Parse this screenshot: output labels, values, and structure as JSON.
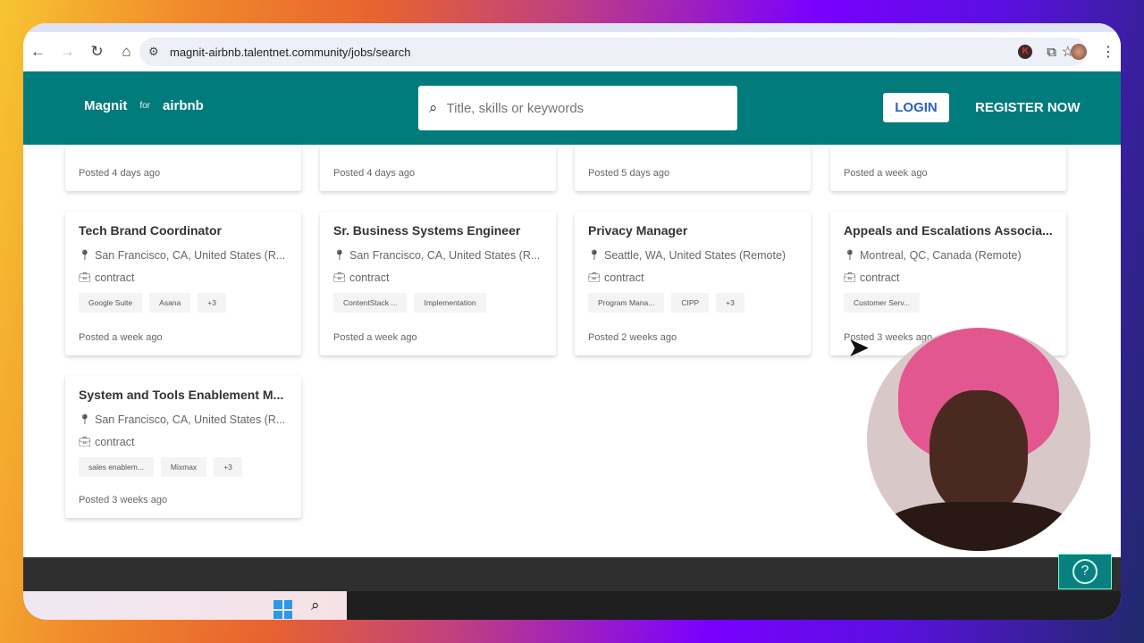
{
  "browser": {
    "url": "magnit-airbnb.talentnet.community/jobs/search",
    "profile_initial": "K"
  },
  "header": {
    "logo_magnit": "Magnit",
    "logo_for": "for",
    "logo_airbnb": "airbnb",
    "search_placeholder": "Title, skills or keywords",
    "login": "LOGIN",
    "register": "REGISTER NOW"
  },
  "partial_cards": [
    {
      "posted": "Posted 4 days ago"
    },
    {
      "posted": "Posted 4 days ago"
    },
    {
      "posted": "Posted 5 days ago"
    },
    {
      "posted": "Posted a week ago"
    }
  ],
  "jobs": [
    {
      "title": "Tech Brand Coordinator",
      "location": "San Francisco, CA, United States (R...",
      "type": "contract",
      "tags": [
        "Google Suite",
        "Asana",
        "+3"
      ],
      "posted": "Posted a week ago"
    },
    {
      "title": "Sr. Business Systems Engineer",
      "location": "San Francisco, CA, United States (R...",
      "type": "contract",
      "tags": [
        "ContentStack ...",
        "Implementation"
      ],
      "posted": "Posted a week ago"
    },
    {
      "title": "Privacy Manager",
      "location": "Seattle, WA, United States (Remote)",
      "type": "contract",
      "tags": [
        "Program Mana...",
        "CIPP",
        "+3"
      ],
      "posted": "Posted 2 weeks ago"
    },
    {
      "title": "Appeals and Escalations Associa...",
      "location": "Montreal, QC, Canada (Remote)",
      "type": "contract",
      "tags": [
        "Customer Serv..."
      ],
      "posted": "Posted 3 weeks ago"
    },
    {
      "title": "System and Tools Enablement M...",
      "location": "San Francisco, CA, United States (R...",
      "type": "contract",
      "tags": [
        "sales enablem...",
        "Mixmax",
        "+3"
      ],
      "posted": "Posted 3 weeks ago"
    }
  ],
  "help": {
    "label": "?"
  }
}
